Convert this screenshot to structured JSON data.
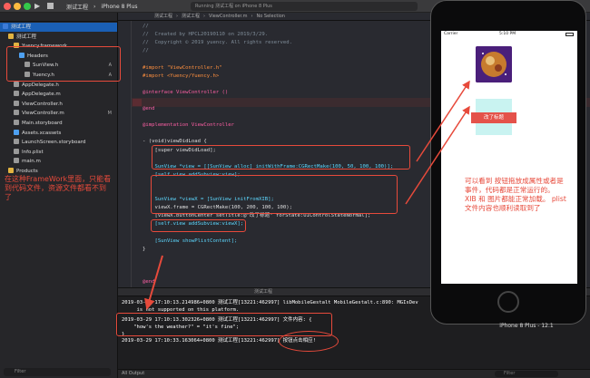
{
  "toolbar": {
    "scheme_label": "测试工程",
    "device_label": "iPhone 8 Plus",
    "status_text": "Running 测试工程 on iPhone 8 Plus"
  },
  "navigator": {
    "rows": [
      {
        "label": "测试工程",
        "badge": "",
        "indent": 0,
        "kind": "project",
        "color": "#3d7bd6"
      },
      {
        "label": "测试工程",
        "badge": "",
        "indent": 1,
        "kind": "folder",
        "color": "#e2b341"
      },
      {
        "label": "Yuency.framework",
        "badge": "",
        "indent": 2,
        "kind": "framework",
        "color": "#e2b341"
      },
      {
        "label": "Headers",
        "badge": "",
        "indent": 3,
        "kind": "folder",
        "color": "#4ea0f0"
      },
      {
        "label": "SunView.h",
        "badge": "A",
        "indent": 4,
        "kind": "file",
        "color": "#999"
      },
      {
        "label": "Yuency.h",
        "badge": "A",
        "indent": 4,
        "kind": "file",
        "color": "#999"
      },
      {
        "label": "AppDelegate.h",
        "badge": "",
        "indent": 2,
        "kind": "file",
        "color": "#999"
      },
      {
        "label": "AppDelegate.m",
        "badge": "",
        "indent": 2,
        "kind": "file",
        "color": "#999"
      },
      {
        "label": "ViewController.h",
        "badge": "",
        "indent": 2,
        "kind": "file",
        "color": "#999"
      },
      {
        "label": "ViewController.m",
        "badge": "M",
        "indent": 2,
        "kind": "file",
        "color": "#999"
      },
      {
        "label": "Main.storyboard",
        "badge": "",
        "indent": 2,
        "kind": "file",
        "color": "#999"
      },
      {
        "label": "Assets.xcassets",
        "badge": "",
        "indent": 2,
        "kind": "file",
        "color": "#4ea0f0"
      },
      {
        "label": "LaunchScreen.storyboard",
        "badge": "",
        "indent": 2,
        "kind": "file",
        "color": "#999"
      },
      {
        "label": "Info.plist",
        "badge": "",
        "indent": 2,
        "kind": "file",
        "color": "#999"
      },
      {
        "label": "main.m",
        "badge": "",
        "indent": 2,
        "kind": "file",
        "color": "#999"
      },
      {
        "label": "Products",
        "badge": "",
        "indent": 1,
        "kind": "folder",
        "color": "#e2b341"
      }
    ],
    "filter_placeholder": "Filter"
  },
  "editor": {
    "breadcrumb": [
      "测试工程",
      "测试工程",
      "ViewController.m",
      "No Selection"
    ],
    "lines": [
      {
        "text": "//",
        "cls": "c-comment"
      },
      {
        "text": "//  Created by HPCL20190110 on 2019/3/29.",
        "cls": "c-comment"
      },
      {
        "text": "//  Copyright © 2019 yuency. All rights reserved.",
        "cls": "c-comment"
      },
      {
        "text": "//",
        "cls": "c-comment"
      },
      {
        "text": "",
        "cls": "c-plain"
      },
      {
        "text": "#import \"ViewController.h\"",
        "cls": "c-pre"
      },
      {
        "text": "#import <Yuency/Yuency.h>",
        "cls": "c-pre"
      },
      {
        "text": "",
        "cls": "c-plain"
      },
      {
        "text": "@interface ViewController ()",
        "cls": "c-kw"
      },
      {
        "text": "",
        "cls": "c-plain"
      },
      {
        "text": "@end",
        "cls": "c-kw"
      },
      {
        "text": "",
        "cls": "c-plain"
      },
      {
        "text": "@implementation ViewController",
        "cls": "c-kw"
      },
      {
        "text": "",
        "cls": "c-plain"
      },
      {
        "text": "- (void)viewDidLoad {",
        "cls": "c-plain"
      },
      {
        "text": "    [super viewDidLoad];",
        "cls": "c-plain"
      },
      {
        "text": "",
        "cls": "c-plain"
      },
      {
        "text": "    SunView *view = [[SunView alloc] initWithFrame:CGRectMake(100, 50, 100, 100)];",
        "cls": "c-type"
      },
      {
        "text": "    [self.view addSubview:view];",
        "cls": "c-type"
      },
      {
        "text": "",
        "cls": "c-plain"
      },
      {
        "text": "",
        "cls": "c-plain"
      },
      {
        "text": "    SunView *viewX = [SunView initFromXIB];",
        "cls": "c-type"
      },
      {
        "text": "    viewX.frame = CGRectMake(100, 200, 100, 100);",
        "cls": "c-plain"
      },
      {
        "text": "    [viewX.buttonCenter setTitle:@\"改了标题\" forState:UIControlStateNormal];",
        "cls": "c-plain"
      },
      {
        "text": "    [self.view addSubview:viewX];",
        "cls": "c-type"
      },
      {
        "text": "",
        "cls": "c-plain"
      },
      {
        "text": "    [SunView showPlistContent];",
        "cls": "c-type"
      },
      {
        "text": "}",
        "cls": "c-plain"
      },
      {
        "text": "",
        "cls": "c-plain"
      },
      {
        "text": "",
        "cls": "c-plain"
      },
      {
        "text": "",
        "cls": "c-plain"
      },
      {
        "text": "@end",
        "cls": "c-kw"
      }
    ]
  },
  "debug_bar": {
    "target": "测试工程"
  },
  "console": {
    "lines": [
      "2019-03-29 17:10:13.214986+0800 测试工程[13221:462997] libMobileGestalt MobileGestalt.c:890: MGIsDev",
      "     is not supported on this platform.",
      "2019-03-29 17:10:13.302326+0800 测试工程[13221:462997] 文件内容: {",
      "    \"how's the weather?\" = \"it's fine\";",
      "}",
      "2019-03-29 17:10:33.163064+0800 测试工程[13221:462997] 按钮点击相应!"
    ],
    "output_label": "All Output",
    "filter_placeholder": "Filter"
  },
  "simulator": {
    "carrier": "Carrier",
    "time": "5:10 PM",
    "button_title": "改了标题",
    "device_label": "iPhone 8 Plus - 12.1"
  },
  "annotations": {
    "left_note": "在这种FrameWork里面，只能看到代码文件，资源文件都看不到了",
    "right_note": "可以看到 按钮拖放成属性或者是事件，代码都是正常运行的。 XIB 和 图片都能正常加载。 plist文件内容也顺利读取到了"
  }
}
